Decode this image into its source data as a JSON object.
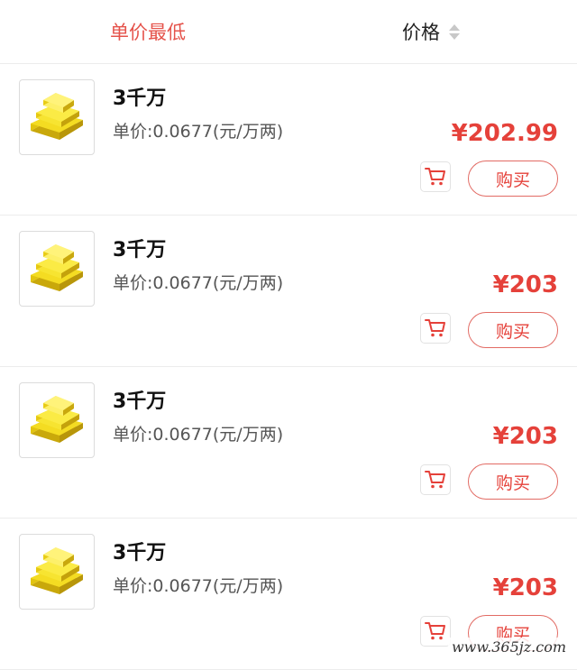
{
  "sort_bar": {
    "active_label": "单价最低",
    "price_label": "价格"
  },
  "items": [
    {
      "name": "3千万",
      "unit_price": "单价:0.0677(元/万两)",
      "price": "¥202.99",
      "buy_label": "购买"
    },
    {
      "name": "3千万",
      "unit_price": "单价:0.0677(元/万两)",
      "price": "¥203",
      "buy_label": "购买"
    },
    {
      "name": "3千万",
      "unit_price": "单价:0.0677(元/万两)",
      "price": "¥203",
      "buy_label": "购买"
    },
    {
      "name": "3千万",
      "unit_price": "单价:0.0677(元/万两)",
      "price": "¥203",
      "buy_label": "购买"
    }
  ],
  "watermark": "www.365jz.com",
  "colors": {
    "accent_red": "#e5413a",
    "sort_active": "#e5534b",
    "divider": "#ececec",
    "gold": "#f2d21a"
  },
  "icons": {
    "thumbnail": "gold-bars-icon",
    "cart": "shopping-cart-icon",
    "sort": "sort-arrows-icon"
  }
}
